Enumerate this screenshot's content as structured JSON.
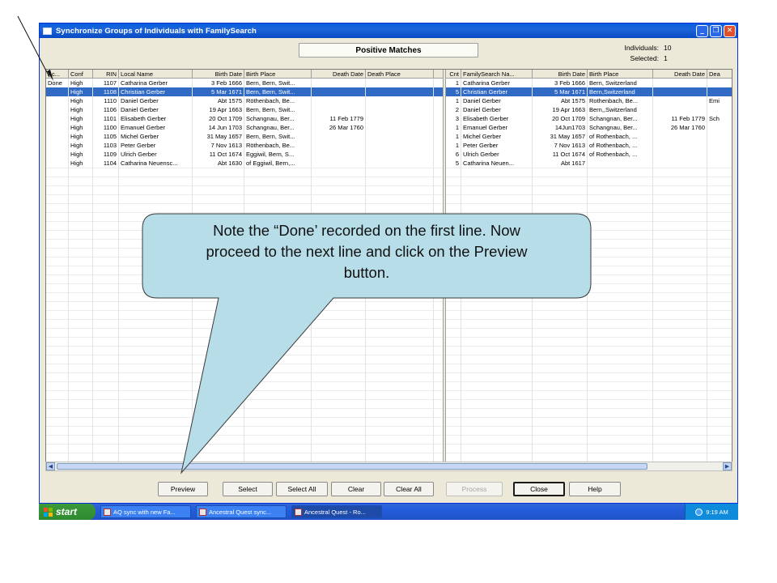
{
  "window": {
    "title": "Synchronize Groups of Individuals with FamilySearch"
  },
  "header": {
    "section_title": "Positive Matches",
    "individuals_label": "Individuals:",
    "individuals_value": "10",
    "selected_label": "Selected:",
    "selected_value": "1"
  },
  "columns": [
    "Ac...",
    "Conf",
    "RIN",
    "Local Name",
    "Birth Date",
    "Birth Place",
    "Death Date",
    "Death Place",
    "Cnt",
    "FamilySearch Na...",
    "Birth Date",
    "Birth Place",
    "Death Date",
    "Dea"
  ],
  "rows": [
    [
      "Done",
      "High",
      "1107",
      "Catharina Gerber",
      "3 Feb 1666",
      "Bern, Bern, Swit...",
      "",
      "",
      "1",
      "Catharina Gerber",
      "3 Feb 1666",
      "Bern, Switzerland",
      "",
      ""
    ],
    [
      "",
      "High",
      "1108",
      "Christian Gerber",
      "5 Mar 1671",
      "Bern, Bern, Swit...",
      "",
      "",
      "5",
      "Christian Gerber",
      "5 Mar 1671",
      "Bern,Switzerland",
      "",
      ""
    ],
    [
      "",
      "High",
      "1110",
      "Daniel Gerber",
      "Abt 1575",
      "Röthenbach, Be...",
      "",
      "",
      "1",
      "Daniel Gerber",
      "Abt 1575",
      "Rothenbach, Be...",
      "",
      "Emi"
    ],
    [
      "",
      "High",
      "1106",
      "Daniel Gerber",
      "19 Apr 1663",
      "Bern, Bern, Swit...",
      "",
      "",
      "2",
      "Daniel Gerber",
      "19 Apr 1663",
      "Bern,,Switzerland",
      "",
      ""
    ],
    [
      "",
      "High",
      "1101",
      "Elisabeth Gerber",
      "20 Oct 1709",
      "Schangnau, Ber...",
      "11 Feb 1779",
      "",
      "3",
      "Elisabeth Gerber",
      "20 Oct 1709",
      "Schangnan, Ber...",
      "11 Feb 1779",
      "Sch"
    ],
    [
      "",
      "High",
      "1100",
      "Emanuel Gerber",
      "14 Jun 1703",
      "Schangnau, Ber...",
      "26 Mar 1760",
      "",
      "1",
      "Emanuel Gerber",
      "14Jun1703",
      "Schangnau, Ber...",
      "26 Mar 1760",
      ""
    ],
    [
      "",
      "High",
      "1105",
      "Michel Gerber",
      "31 May 1657",
      "Bern, Bern, Swit...",
      "",
      "",
      "1",
      "Michel Gerber",
      "31 May 1657",
      "of Rothenbach, ...",
      "",
      ""
    ],
    [
      "",
      "High",
      "1103",
      "Peter Gerber",
      "7 Nov 1613",
      "Röthenbach, Be...",
      "",
      "",
      "1",
      "Peter Gerber",
      "7 Nov 1613",
      "of Rothenbach, ...",
      "",
      ""
    ],
    [
      "",
      "High",
      "1109",
      "Ulrich Gerber",
      "11 Oct 1674",
      "Eggiwil, Bern, S...",
      "",
      "",
      "6",
      "Ulrich Gerber",
      "11 Oct 1674",
      "of Rothenbach, ...",
      "",
      ""
    ],
    [
      "",
      "High",
      "1104",
      "Catharina Neuensc...",
      "Abt 1630",
      "of Eggiwil, Bern,...",
      "",
      "",
      "5",
      "Catharina Neuen...",
      "Abt 1617",
      "",
      "",
      ""
    ]
  ],
  "selected_row": 1,
  "buttons": {
    "preview": "Preview",
    "select": "Select",
    "select_all": "Select All",
    "clear": "Clear",
    "clear_all": "Clear All",
    "process": "Process",
    "close": "Close",
    "help": "Help"
  },
  "taskbar": {
    "start": "start",
    "tasks": [
      "AQ sync with new Fa...",
      "Ancestral Quest sync...",
      "Ancestral Quest - Ro..."
    ],
    "clock": "9:19 AM"
  },
  "callout": {
    "line1": "Note the “Done’ recorded on the first line.  Now",
    "line2": "proceed to the next line and click on the Preview",
    "line3": "button."
  },
  "colors": {
    "title_bar": "#0a5fe0",
    "selection": "#316ac5",
    "callout_fill": "#b6dde8",
    "taskbar": "#245edb",
    "start_button": "#3b9a3b"
  }
}
